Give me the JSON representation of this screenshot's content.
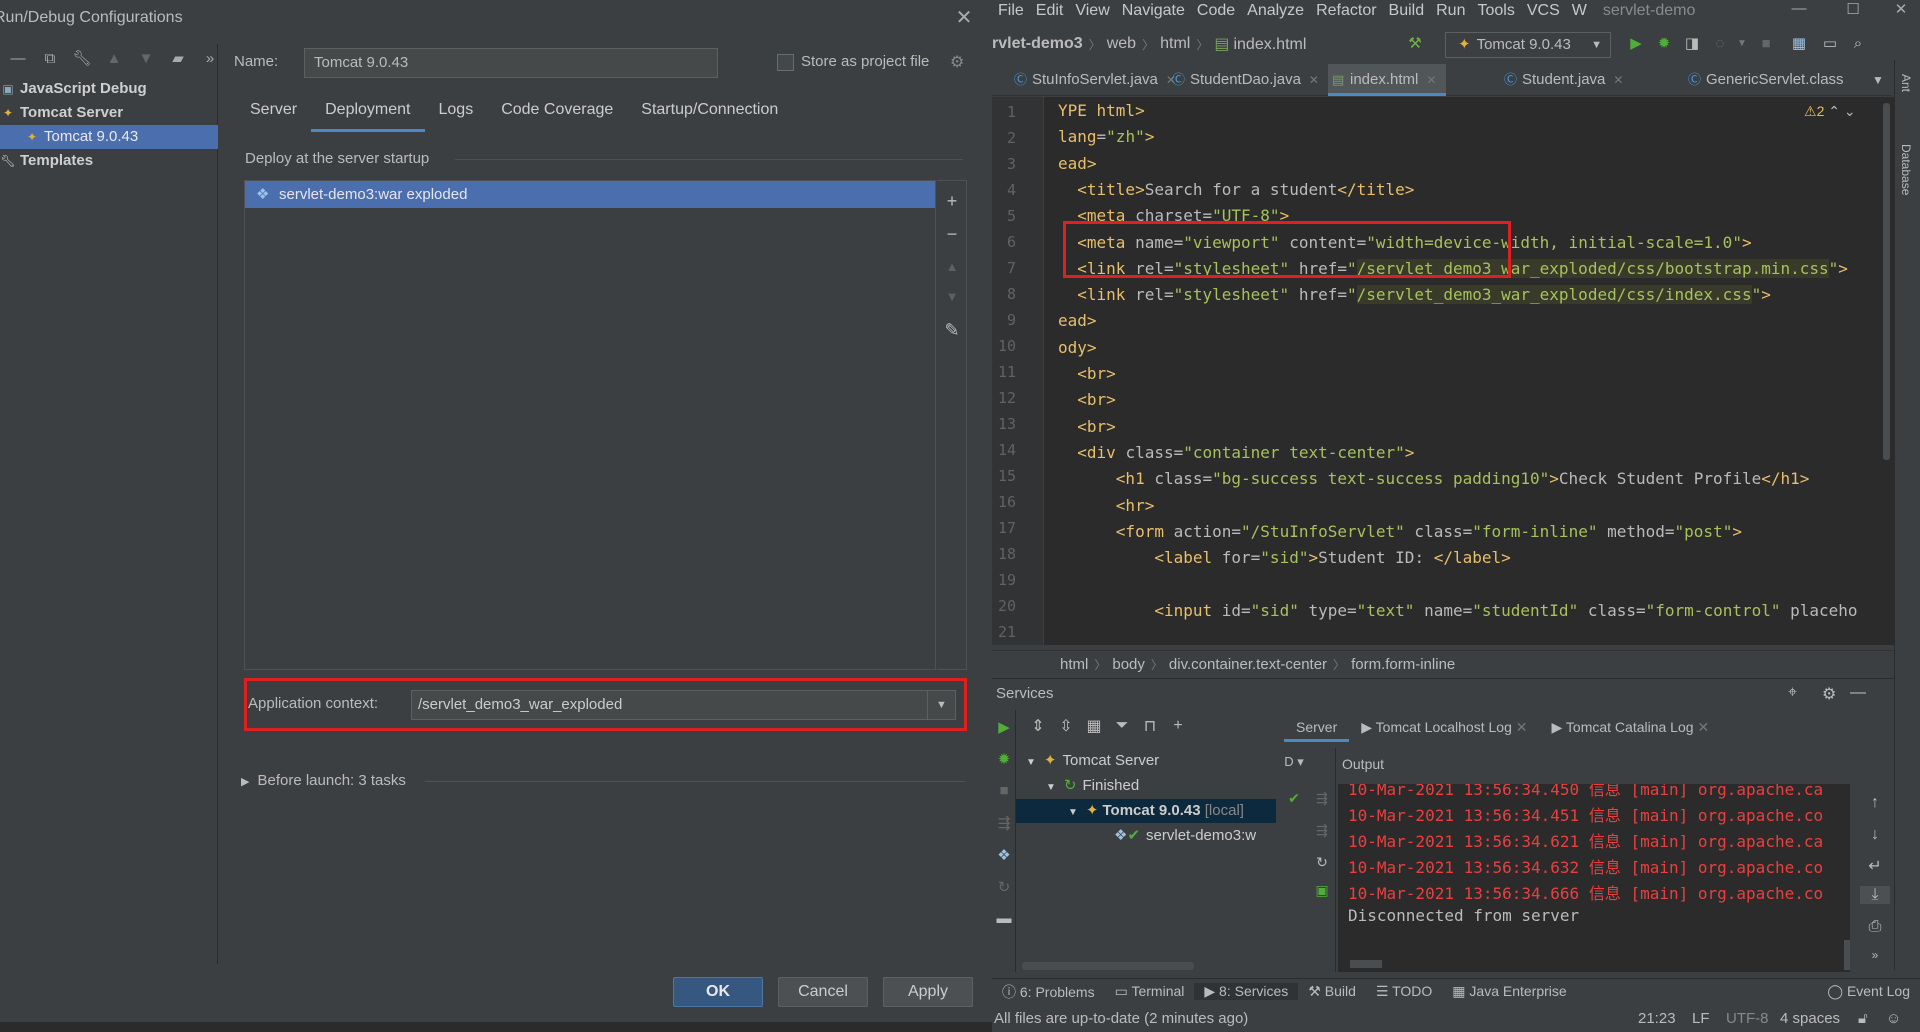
{
  "dialog": {
    "title": "Run/Debug Configurations",
    "toolbar_icons": [
      "minus-icon",
      "copy-icon",
      "wrench-icon",
      "arrow-up-icon",
      "arrow-down-icon",
      "folder-icon",
      "more-icon"
    ],
    "tree": {
      "javascript_debug": "JavaScript Debug",
      "tomcat_server": "Tomcat Server",
      "tomcat_config": "Tomcat 9.0.43",
      "templates": "Templates"
    },
    "name_label": "Name:",
    "name_value": "Tomcat 9.0.43",
    "store_label": "Store as project file",
    "tabs": [
      "Server",
      "Deployment",
      "Logs",
      "Code Coverage",
      "Startup/Connection"
    ],
    "active_tab": "Deployment",
    "deploy_header": "Deploy at the server startup",
    "deploy_items": [
      "servlet-demo3:war exploded"
    ],
    "app_context_label": "Application context:",
    "app_context_value": "/servlet_demo3_war_exploded",
    "before_launch": "Before launch: 3 tasks",
    "ok": "OK",
    "cancel": "Cancel",
    "apply": "Apply"
  },
  "ide": {
    "menu": [
      "File",
      "Edit",
      "View",
      "Navigate",
      "Code",
      "Analyze",
      "Refactor",
      "Build",
      "Run",
      "Tools",
      "VCS",
      "W"
    ],
    "project_title": "servlet-demo",
    "nav": [
      "rvlet-demo3",
      "web",
      "html",
      "index.html"
    ],
    "run_config": "Tomcat 9.0.43",
    "editor_tabs": [
      "StuInfoServlet.java",
      "StudentDao.java",
      "index.html",
      "Student.java",
      "GenericServlet.class"
    ],
    "active_editor_tab": "index.html",
    "warnings": "2",
    "breadcrumb": [
      "html",
      "body",
      "div.container.text-center",
      "form.form-inline"
    ],
    "services_title": "Services",
    "services_tree": {
      "root": "Tomcat Server",
      "finished": "Finished",
      "server": "Tomcat 9.0.43",
      "server_suffix": "[local]",
      "artifact": "servlet-demo3:w"
    },
    "right_tabs": [
      "Server",
      "Tomcat Localhost Log",
      "Tomcat Catalina Log"
    ],
    "output_header": "Output",
    "output_col": "D",
    "output_lines": [
      "10-Mar-2021 13:56:34.450 信息 [main] org.apache.ca",
      "10-Mar-2021 13:56:34.451 信息 [main] org.apache.co",
      "10-Mar-2021 13:56:34.621 信息 [main] org.apache.ca",
      "10-Mar-2021 13:56:34.632 信息 [main] org.apache.co",
      "10-Mar-2021 13:56:34.666 信息 [main] org.apache.co",
      "Disconnected from server"
    ],
    "bottom_tabs": [
      "6: Problems",
      "Terminal",
      "8: Services",
      "Build",
      "TODO",
      "Java Enterprise"
    ],
    "event_log": "Event Log",
    "status_msg": "All files are up-to-date (2 minutes ago)",
    "status_pos": "21:23",
    "status_lf": "LF",
    "status_enc": "UTF-8",
    "status_indent": "4 spaces",
    "right_strip": [
      "Ant",
      "Database"
    ],
    "line_numbers": [
      "1",
      "2",
      "3",
      "4",
      "5",
      "6",
      "7",
      "8",
      "9",
      "10",
      "11",
      "12",
      "13",
      "14",
      "15",
      "16",
      "17",
      "18",
      "19",
      "20",
      "21"
    ]
  }
}
